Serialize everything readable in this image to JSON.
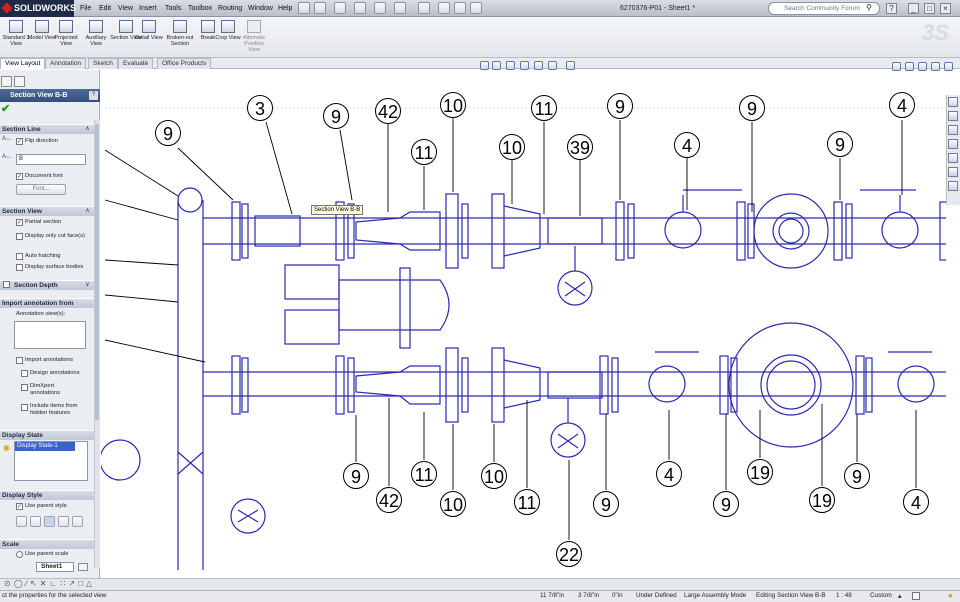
{
  "app": {
    "name": "SOLIDWORKS",
    "document_title": "6270376-P01 - Sheet1 *"
  },
  "menu": [
    "File",
    "Edit",
    "View",
    "Insert",
    "Tools",
    "Toolbox",
    "Routing",
    "Window",
    "Help"
  ],
  "search": {
    "placeholder": "Search Community Forum"
  },
  "toolbar": [
    {
      "label": "Standard 3 View",
      "icon": "standard-3-view-icon"
    },
    {
      "label": "Model View",
      "icon": "model-view-icon"
    },
    {
      "label": "Projected View",
      "icon": "projected-view-icon"
    },
    {
      "label": "Auxiliary View",
      "icon": "auxiliary-view-icon"
    },
    {
      "label": "Section View",
      "icon": "section-view-icon"
    },
    {
      "label": "Detail View",
      "icon": "detail-view-icon"
    },
    {
      "label": "Broken-out Section",
      "icon": "broken-out-section-icon"
    },
    {
      "label": "Break",
      "icon": "break-icon"
    },
    {
      "label": "Crop View",
      "icon": "crop-view-icon"
    },
    {
      "label": "Alternate Position View",
      "icon": "alternate-position-view-icon"
    }
  ],
  "tabs": [
    "View Layout",
    "Annotation",
    "Sketch",
    "Evaluate",
    "Office Products"
  ],
  "property_manager": {
    "title": "Section View B-B",
    "section_line": {
      "header": "Section Line",
      "flip_direction": "Flip direction",
      "label_value": "B",
      "document_font": "Document font",
      "font_button": "Font..."
    },
    "section_view": {
      "header": "Section View",
      "options": [
        "Partial section",
        "Display only cut face(s)",
        "Auto hatching",
        "Display surface bodies"
      ],
      "checked": [
        true,
        false,
        false,
        false
      ]
    },
    "section_depth": {
      "header": "Section Depth"
    },
    "import_annotation": {
      "header": "Import annotation from",
      "annotation_views_label": "Annotation view(s):",
      "options": [
        "Import annotations",
        "Design annotations",
        "DimXpert annotations",
        "Include items from hidden features"
      ]
    },
    "display_state": {
      "header": "Display State",
      "item": "Display State-1"
    },
    "display_style": {
      "header": "Display Style",
      "use_parent": "Use parent style"
    },
    "scale": {
      "header": "Scale",
      "use_parent": "Use parent scale"
    }
  },
  "tooltip": "Section View B-B",
  "sheet_tab": "Sheet1",
  "status": {
    "message": "ct the properties for the selected view",
    "coord1": "11 7/8\"in",
    "coord2": "3 7/8\"in",
    "coord3": "0\"in",
    "state": "Under Defined",
    "mode": "Large Assembly Mode",
    "editing": "Editing Section View B-B",
    "scale": "1 : 48",
    "units": "Custom"
  },
  "balloons": {
    "top": [
      "9",
      "3",
      "9",
      "42",
      "11",
      "10",
      "10",
      "11",
      "39",
      "9",
      "4",
      "9",
      "9",
      "4"
    ],
    "bottom": [
      "9",
      "42",
      "11",
      "10",
      "10",
      "11",
      "9",
      "4",
      "9",
      "19",
      "19",
      "9",
      "4",
      "22"
    ]
  }
}
